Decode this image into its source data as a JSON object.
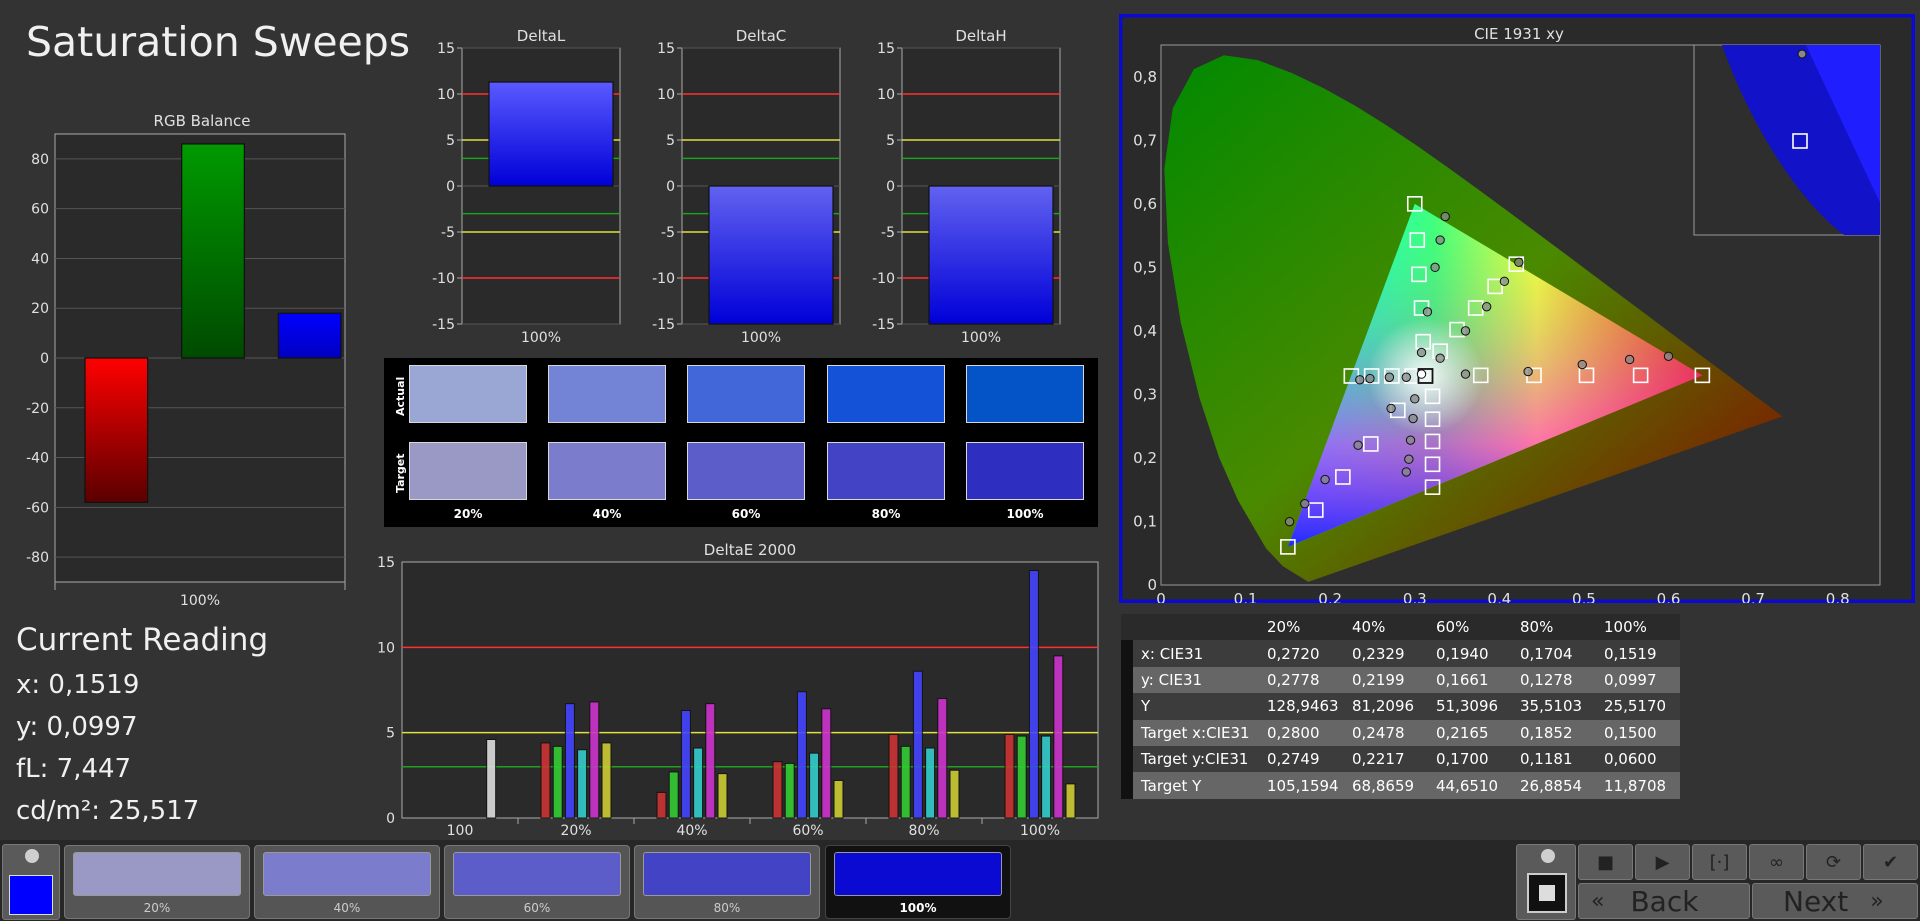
{
  "title": "Saturation Sweeps",
  "current_reading": {
    "title": "Current Reading",
    "x": "x: 0,1519",
    "y": "y: 0,0997",
    "fl": "fL: 7,447",
    "cdm2": "cd/m²: 25,517"
  },
  "swatches": {
    "row_actual": "Actual",
    "row_target": "Target",
    "labels": [
      "20%",
      "40%",
      "60%",
      "80%",
      "100%"
    ],
    "actual_colors": [
      "#9aa6d3",
      "#7383d6",
      "#4167d8",
      "#1453d8",
      "#0454c8"
    ],
    "target_colors": [
      "#9a98c4",
      "#7c7ccc",
      "#5d5dc9",
      "#4343c5",
      "#2e2ec0"
    ]
  },
  "table": {
    "headers": [
      "",
      "20%",
      "40%",
      "60%",
      "80%",
      "100%"
    ],
    "rows": [
      {
        "label": "x: CIE31",
        "values": [
          "0,2720",
          "0,2329",
          "0,1940",
          "0,1704",
          "0,1519"
        ]
      },
      {
        "label": "y: CIE31",
        "values": [
          "0,2778",
          "0,2199",
          "0,1661",
          "0,1278",
          "0,0997"
        ]
      },
      {
        "label": "Y",
        "values": [
          "128,9463",
          "81,2096",
          "51,3096",
          "35,5103",
          "25,5170"
        ]
      },
      {
        "label": "Target x:CIE31",
        "values": [
          "0,2800",
          "0,2478",
          "0,2165",
          "0,1852",
          "0,1500"
        ]
      },
      {
        "label": "Target y:CIE31",
        "values": [
          "0,2749",
          "0,2217",
          "0,1700",
          "0,1181",
          "0,0600"
        ]
      },
      {
        "label": "Target Y",
        "values": [
          "105,1594",
          "68,8659",
          "44,6510",
          "26,8854",
          "11,8708"
        ]
      }
    ]
  },
  "bottom": {
    "patches": [
      {
        "label": "20%",
        "color": "#9a98c4"
      },
      {
        "label": "40%",
        "color": "#7c7ccc"
      },
      {
        "label": "60%",
        "color": "#5d5dc9"
      },
      {
        "label": "80%",
        "color": "#4343c5"
      },
      {
        "label": "100%",
        "color": "#0a0ad2",
        "active": true
      }
    ],
    "current_color": "#0000ff",
    "back_label": "Back",
    "next_label": "Next",
    "back_icon": "double-chevron-left-icon",
    "next_icon": "double-chevron-right-icon",
    "controls": [
      "stop-icon",
      "play-icon",
      "bracket-icon",
      "infinity-icon",
      "refresh-icon",
      "check-icon"
    ]
  },
  "chart_data": [
    {
      "type": "bar",
      "title": "RGB Balance",
      "categories": [
        "100%"
      ],
      "series": [
        {
          "color": "#ff0000",
          "values": [
            -58
          ]
        },
        {
          "color": "#00a000",
          "values": [
            86
          ]
        },
        {
          "color": "#0000ff",
          "values": [
            18
          ]
        }
      ],
      "ylim": [
        -90,
        90
      ],
      "yticks": [
        -80,
        -60,
        -40,
        -20,
        0,
        20,
        40,
        60,
        80
      ],
      "grid": true
    },
    {
      "type": "bar",
      "title": "DeltaL",
      "categories": [
        "100%"
      ],
      "values": [
        11.3
      ],
      "ylim": [
        -15,
        15
      ],
      "yticks": [
        -15,
        -10,
        -5,
        0,
        5,
        10,
        15
      ],
      "ref_lines": [
        {
          "y": 10,
          "color": "#ff3030"
        },
        {
          "y": -10,
          "color": "#ff3030"
        },
        {
          "y": 5,
          "color": "#e0e040"
        },
        {
          "y": -5,
          "color": "#e0e040"
        },
        {
          "y": 3,
          "color": "#20a020"
        },
        {
          "y": -3,
          "color": "#20a020"
        }
      ]
    },
    {
      "type": "bar",
      "title": "DeltaC",
      "categories": [
        "100%"
      ],
      "values": [
        -15
      ],
      "ylim": [
        -15,
        15
      ],
      "yticks": [
        -15,
        -10,
        -5,
        0,
        5,
        10,
        15
      ],
      "ref_lines": [
        {
          "y": 10,
          "color": "#ff3030"
        },
        {
          "y": -10,
          "color": "#ff3030"
        },
        {
          "y": 5,
          "color": "#e0e040"
        },
        {
          "y": -5,
          "color": "#e0e040"
        },
        {
          "y": 3,
          "color": "#20a020"
        },
        {
          "y": -3,
          "color": "#20a020"
        }
      ]
    },
    {
      "type": "bar",
      "title": "DeltaH",
      "categories": [
        "100%"
      ],
      "values": [
        -15
      ],
      "ylim": [
        -15,
        15
      ],
      "yticks": [
        -15,
        -10,
        -5,
        0,
        5,
        10,
        15
      ],
      "ref_lines": [
        {
          "y": 10,
          "color": "#ff3030"
        },
        {
          "y": -10,
          "color": "#ff3030"
        },
        {
          "y": 5,
          "color": "#e0e040"
        },
        {
          "y": -5,
          "color": "#e0e040"
        },
        {
          "y": 3,
          "color": "#20a020"
        },
        {
          "y": -3,
          "color": "#20a020"
        }
      ]
    },
    {
      "type": "bar",
      "title": "DeltaE 2000",
      "categories": [
        "100",
        "20%",
        "40%",
        "60%",
        "80%",
        "100%"
      ],
      "ylim": [
        0,
        15
      ],
      "yticks": [
        0,
        5,
        10,
        15
      ],
      "ref_lines": [
        {
          "y": 10,
          "color": "#ff3030"
        },
        {
          "y": 5,
          "color": "#e0e040"
        },
        {
          "y": 3,
          "color": "#20a020"
        }
      ],
      "series": [
        {
          "color": "#cc3333",
          "values": [
            null,
            4.4,
            1.5,
            3.3,
            4.9,
            4.9
          ]
        },
        {
          "color": "#33cc33",
          "values": [
            null,
            4.2,
            2.7,
            3.2,
            4.2,
            4.8
          ]
        },
        {
          "color": "#4444ff",
          "values": [
            null,
            6.7,
            6.3,
            7.4,
            8.6,
            14.5
          ]
        },
        {
          "color": "#33cccc",
          "values": [
            null,
            4.0,
            4.1,
            3.8,
            4.1,
            4.8
          ]
        },
        {
          "color": "#cc33cc",
          "values": [
            null,
            6.8,
            6.7,
            6.4,
            7.0,
            9.5
          ]
        },
        {
          "color": "#cccc33",
          "values": [
            null,
            4.4,
            2.6,
            2.2,
            2.8,
            2.0
          ]
        },
        {
          "color": "#dddddd",
          "values": [
            4.6,
            null,
            null,
            null,
            null,
            null
          ]
        }
      ]
    },
    {
      "type": "scatter",
      "title": "CIE 1931 xy",
      "xlim": [
        0,
        0.85
      ],
      "ylim": [
        0,
        0.85
      ],
      "xticks": [
        "0",
        "0,1",
        "0,2",
        "0,3",
        "0,4",
        "0,5",
        "0,6",
        "0,7",
        "0,8"
      ],
      "yticks": [
        "0",
        "0,1",
        "0,2",
        "0,3",
        "0,4",
        "0,5",
        "0,6",
        "0,7",
        "0,8"
      ],
      "gamut": [
        [
          0.64,
          0.33
        ],
        [
          0.3,
          0.6
        ],
        [
          0.15,
          0.06
        ]
      ],
      "white": [
        0.3127,
        0.329
      ],
      "targets": [
        [
          0.64,
          0.33
        ],
        [
          0.567,
          0.33
        ],
        [
          0.503,
          0.33
        ],
        [
          0.441,
          0.33
        ],
        [
          0.378,
          0.33
        ],
        [
          0.3,
          0.6
        ],
        [
          0.303,
          0.543
        ],
        [
          0.305,
          0.489
        ],
        [
          0.308,
          0.436
        ],
        [
          0.31,
          0.383
        ],
        [
          0.15,
          0.06
        ],
        [
          0.183,
          0.118
        ],
        [
          0.215,
          0.17
        ],
        [
          0.248,
          0.222
        ],
        [
          0.28,
          0.275
        ],
        [
          0.225,
          0.329
        ],
        [
          0.249,
          0.329
        ],
        [
          0.273,
          0.329
        ],
        [
          0.297,
          0.329
        ],
        [
          0.321,
          0.154
        ],
        [
          0.321,
          0.19
        ],
        [
          0.321,
          0.226
        ],
        [
          0.321,
          0.261
        ],
        [
          0.321,
          0.297
        ],
        [
          0.42,
          0.505
        ],
        [
          0.395,
          0.47
        ],
        [
          0.372,
          0.436
        ],
        [
          0.35,
          0.402
        ],
        [
          0.33,
          0.368
        ]
      ],
      "measured": [
        [
          0.6,
          0.36
        ],
        [
          0.554,
          0.355
        ],
        [
          0.498,
          0.347
        ],
        [
          0.434,
          0.336
        ],
        [
          0.36,
          0.332
        ],
        [
          0.336,
          0.58
        ],
        [
          0.33,
          0.543
        ],
        [
          0.324,
          0.5
        ],
        [
          0.315,
          0.43
        ],
        [
          0.308,
          0.366
        ],
        [
          0.152,
          0.0997
        ],
        [
          0.17,
          0.128
        ],
        [
          0.194,
          0.166
        ],
        [
          0.233,
          0.22
        ],
        [
          0.272,
          0.278
        ],
        [
          0.235,
          0.323
        ],
        [
          0.247,
          0.325
        ],
        [
          0.27,
          0.327
        ],
        [
          0.29,
          0.327
        ],
        [
          0.29,
          0.178
        ],
        [
          0.293,
          0.198
        ],
        [
          0.295,
          0.228
        ],
        [
          0.298,
          0.262
        ],
        [
          0.3,
          0.293
        ],
        [
          0.423,
          0.508
        ],
        [
          0.406,
          0.478
        ],
        [
          0.385,
          0.438
        ],
        [
          0.36,
          0.4
        ],
        [
          0.33,
          0.357
        ]
      ],
      "inset_target": [
        0.15,
        0.06
      ],
      "inset_measured": [
        0.1519,
        0.0997
      ]
    }
  ]
}
